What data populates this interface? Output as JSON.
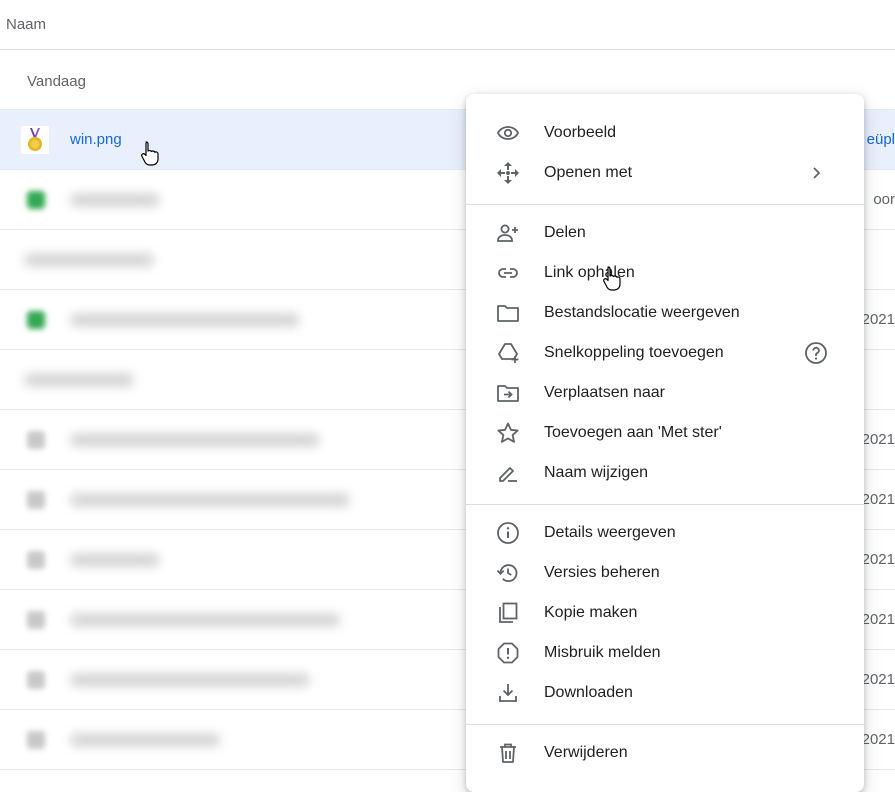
{
  "header": {
    "name_column": "Naam"
  },
  "section": {
    "today": "Vandaag"
  },
  "selected_file": {
    "name": "win.png",
    "right_text": "eüpl"
  },
  "blurred_rows_right": [
    "oor",
    "",
    "2021",
    "",
    "2021",
    "2021",
    "2021",
    "2021",
    "2021",
    "2021"
  ],
  "menu": {
    "preview": "Voorbeeld",
    "open_with": "Openen met",
    "share": "Delen",
    "get_link": "Link ophalen",
    "show_location": "Bestandslocatie weergeven",
    "add_shortcut": "Snelkoppeling toevoegen",
    "move_to": "Verplaatsen naar",
    "add_star": "Toevoegen aan 'Met ster'",
    "rename": "Naam wijzigen",
    "details": "Details weergeven",
    "versions": "Versies beheren",
    "copy": "Kopie maken",
    "report": "Misbruik melden",
    "download": "Downloaden",
    "delete": "Verwijderen"
  },
  "colors": {
    "accent": "#1967d2",
    "selected_row": "#e8f0fe",
    "icon": "#5f6368"
  },
  "icons": [
    "eye-icon",
    "move-arrows-icon",
    "person-add-icon",
    "link-icon",
    "folder-icon",
    "drive-add-icon",
    "help-circle-icon",
    "folder-move-icon",
    "star-icon",
    "rename-icon",
    "info-icon",
    "history-icon",
    "copy-icon",
    "report-icon",
    "download-icon",
    "trash-icon",
    "chevron-right-icon",
    "hand-cursor-icon",
    "medal-image-icon"
  ]
}
